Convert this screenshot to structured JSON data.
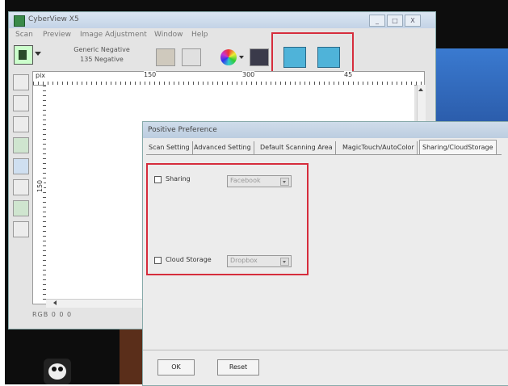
{
  "window": {
    "title": "CyberView X5",
    "controls": [
      "_",
      "□",
      "X"
    ]
  },
  "menu": [
    "Scan",
    "Preview",
    "Image Adjustment",
    "Window",
    "Help"
  ],
  "toolbar": {
    "film_type_line1": "Generic Negative",
    "film_type_line2": "135 Negative"
  },
  "ruler": {
    "unit": "pix",
    "top_labels": [
      "150",
      "300",
      "45"
    ],
    "left_label": "150"
  },
  "statusbar": {
    "text": "RGB 0 0 0"
  },
  "dialog": {
    "title": "Positive Preference",
    "tabs": [
      "Scan Setting",
      "Advanced Setting",
      "Default Scanning Area",
      "MagicTouch/AutoColor",
      "Sharing/CloudStorage"
    ],
    "active_tab": "Sharing/CloudStorage",
    "sharing": {
      "label": "Sharing",
      "checked": false,
      "selected": "Facebook"
    },
    "cloud_storage": {
      "label": "Cloud Storage",
      "checked": false,
      "selected": "Dropbox"
    },
    "ok_label": "OK",
    "reset_label": "Reset"
  },
  "colors": {
    "highlight": "#d62d3c",
    "title_bar": "#c3d3e6",
    "accent_icon": "#4fb3d9"
  }
}
